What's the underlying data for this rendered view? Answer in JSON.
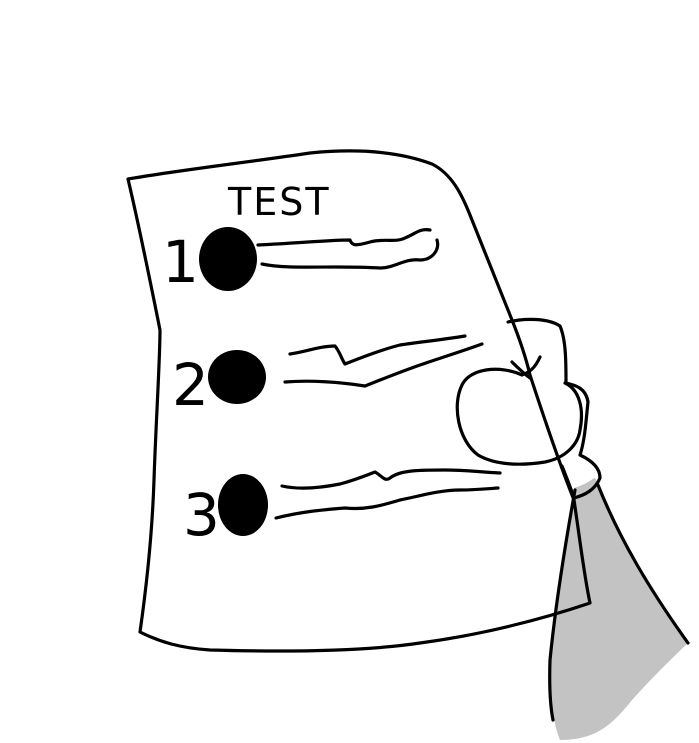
{
  "title": "TEST",
  "questions": [
    {
      "number": "1",
      "answer_filled": true
    },
    {
      "number": "2",
      "answer_filled": true
    },
    {
      "number": "3",
      "answer_filled": true
    }
  ],
  "colors": {
    "ink": "#000000",
    "paper": "#ffffff",
    "sleeve": "#c3c3c3"
  }
}
